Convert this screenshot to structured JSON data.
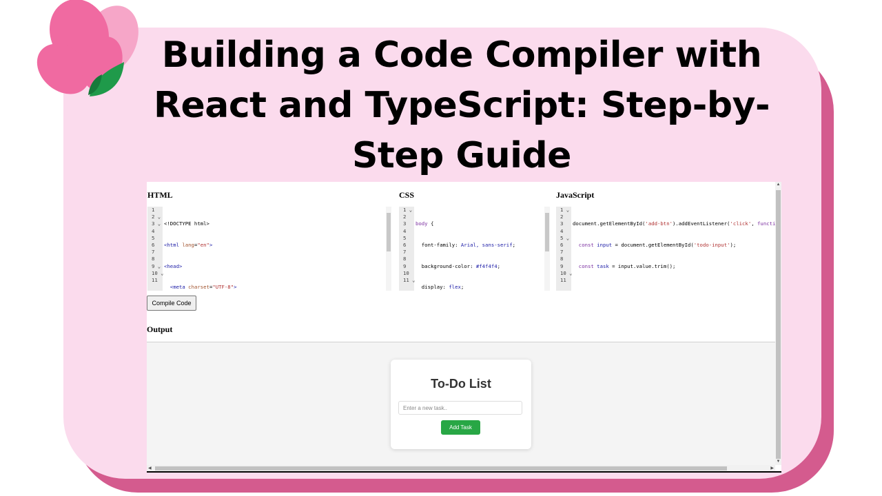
{
  "banner": {
    "title_lines": [
      "Building a Code Compiler with",
      "React and TypeScript: Step-by-",
      "Step Guide"
    ],
    "colors": {
      "card": "#fbdbed",
      "card_shadow": "#d45b8e",
      "petal": "#f06aa1",
      "leaf": "#1f9a4a"
    }
  },
  "screenshot": {
    "panes": [
      {
        "label": "HTML",
        "gutter": [
          "1",
          "2 ⌄",
          "3 ⌄",
          "4",
          "5",
          "6",
          "7",
          "8",
          "9 ⌄",
          "10 ⌄",
          "11"
        ]
      },
      {
        "label": "CSS",
        "gutter": [
          "1 ⌄",
          "2",
          "3",
          "4",
          "5",
          "6",
          "7",
          "8",
          "9",
          "10",
          "11 ⌄"
        ]
      },
      {
        "label": "JavaScript",
        "gutter": [
          "1 ⌄",
          "2",
          "3",
          "4",
          "5 ⌄",
          "6",
          "7",
          "8",
          "9",
          "10 ⌄",
          "11"
        ]
      }
    ],
    "compile_button": "Compile Code",
    "output_label": "Output",
    "preview": {
      "title": "To-Do List",
      "input_placeholder": "Enter a new task..",
      "add_button": "Add Task"
    }
  }
}
